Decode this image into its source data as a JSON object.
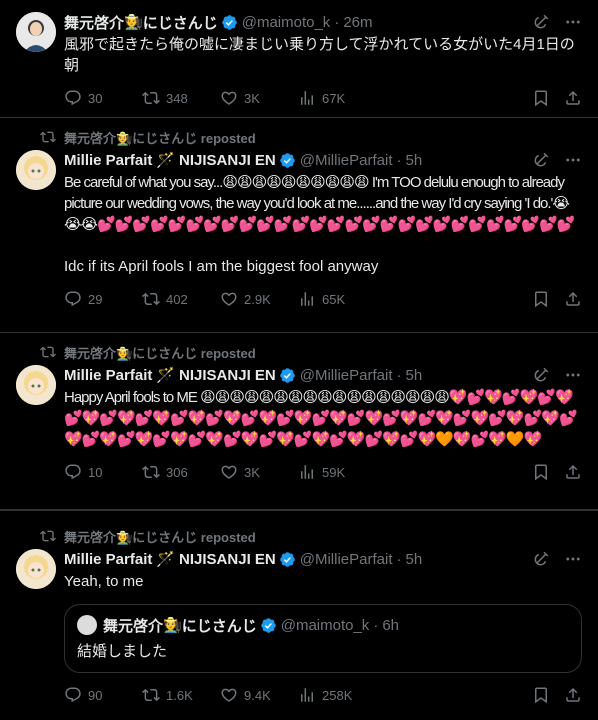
{
  "tweets": [
    {
      "author_name": "舞元啓介",
      "author_badge": "🧑‍🌾",
      "author_suffix": "にじさんじ",
      "handle": "@maimoto_k",
      "time": "26m",
      "text": "風邪で起きたら俺の嘘に凄まじい乗り方して浮かれている女がいた4月1日の朝",
      "replies": "30",
      "reposts": "348",
      "likes": "3K",
      "views": "67K"
    },
    {
      "repost_label": "舞元啓介🧑‍🌾にじさんじ reposted",
      "author_name": "Millie Parfait",
      "author_badge": "🪄",
      "author_suffix": "NIJISANJI EN",
      "handle": "@MillieParfait",
      "time": "5h",
      "text_line1": "Be careful of what you say...😩😩😩😩😩😩😩😩😩😩 I'm TOO delulu enough to already picture our wedding vows, the way you'd look at me......and the way I'd cry saying 'I do.'😭😭😭💕💕💕💕💕💕💕💕💕💕💕💕💕💕💕💕💕💕💕💕💕💕💕💕💕💕💕",
      "text_line2": "Idc if its April fools I am the biggest fool anyway",
      "replies": "29",
      "reposts": "402",
      "likes": "2.9K",
      "views": "65K"
    },
    {
      "repost_label": "舞元啓介🧑‍🌾にじさんじ reposted",
      "author_name": "Millie Parfait",
      "author_badge": "🪄",
      "author_suffix": "NIJISANJI EN",
      "handle": "@MillieParfait",
      "time": "5h",
      "text": "Happy April fools to ME 😩😩😩😩😩😩😩😩😩😩😩😩😩😩😩😩😩💖💕💖💕💖💕💖💕💖💕💖💕💖💕💖💕💖💕💖💕💖💕💖💕💖💕💖💕💖💕💖💕💖💕💖💕💖💕💖💕💖💕💖💕💖💕💖💕💖💕💖💕💖💕💖💕💖🧡💖💕💖🧡💖",
      "replies": "10",
      "reposts": "306",
      "likes": "3K",
      "views": "59K"
    },
    {
      "repost_label": "舞元啓介🧑‍🌾にじさんじ reposted",
      "author_name": "Millie Parfait",
      "author_badge": "🪄",
      "author_suffix": "NIJISANJI EN",
      "handle": "@MillieParfait",
      "time": "5h",
      "text": "Yeah, to me",
      "quote": {
        "author_name": "舞元啓介",
        "author_badge": "🧑‍🌾",
        "author_suffix": "にじさんじ",
        "handle": "@maimoto_k",
        "time": "6h",
        "text": "結婚しました"
      },
      "replies": "90",
      "reposts": "1.6K",
      "likes": "9.4K",
      "views": "258K"
    }
  ],
  "icons": {
    "reply": "reply-icon",
    "repost": "repost-icon",
    "like": "like-icon",
    "views": "views-icon",
    "bookmark": "bookmark-icon",
    "share": "share-icon",
    "grok": "grok-icon",
    "more": "more-icon",
    "verified": "verified-badge-icon"
  },
  "colors": {
    "background": "#000000",
    "text": "#e7e9ea",
    "muted": "#71767b",
    "verified": "#1d9bf0",
    "border": "#2f3336"
  }
}
